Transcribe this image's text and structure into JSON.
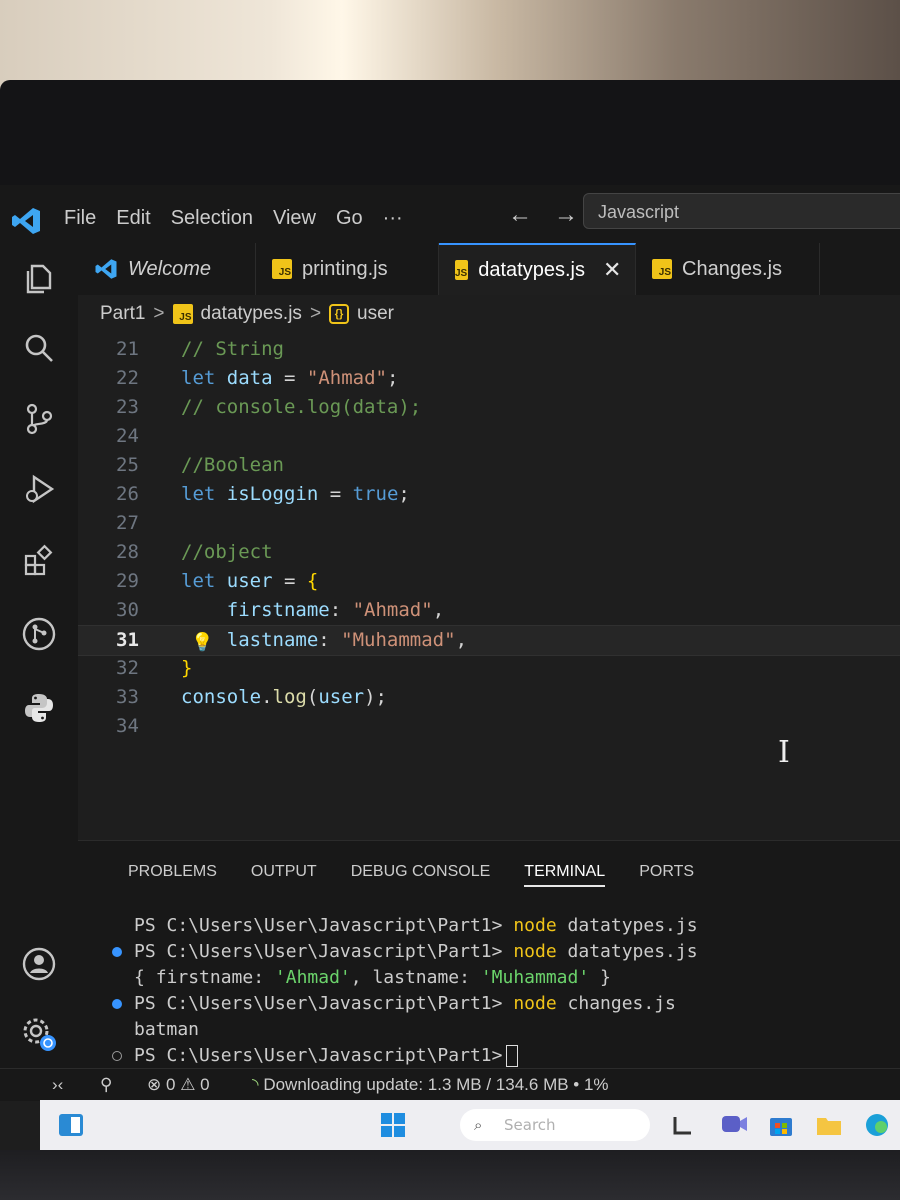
{
  "menu": [
    "File",
    "Edit",
    "Selection",
    "View",
    "Go",
    "···"
  ],
  "command_center": "Javascript",
  "tabs": [
    {
      "label": "Welcome",
      "icon": "vscode-logo-icon",
      "active": false
    },
    {
      "label": "printing.js",
      "icon": "js-file-icon",
      "active": false
    },
    {
      "label": "datatypes.js",
      "icon": "js-file-icon",
      "active": true
    },
    {
      "label": "Changes.js",
      "icon": "js-file-icon",
      "active": false
    }
  ],
  "tab_close": "✕",
  "breadcrumb": {
    "folder": "Part1",
    "file": "datatypes.js",
    "symbol": "user",
    "separator": ">"
  },
  "editor": {
    "current_line": 31,
    "lines": [
      {
        "n": "21",
        "text": "// String"
      },
      {
        "n": "22",
        "text": "let data = \"Ahmad\";"
      },
      {
        "n": "23",
        "text": "// console.log(data);"
      },
      {
        "n": "24",
        "text": ""
      },
      {
        "n": "25",
        "text": "//Boolean"
      },
      {
        "n": "26",
        "text": "let isLoggin = true;"
      },
      {
        "n": "27",
        "text": ""
      },
      {
        "n": "28",
        "text": "//object"
      },
      {
        "n": "29",
        "text": "let user = {"
      },
      {
        "n": "30",
        "text": "    firstname: \"Ahmad\","
      },
      {
        "n": "31",
        "text": "    lastname: \"Muhammad\","
      },
      {
        "n": "32",
        "text": "}"
      },
      {
        "n": "33",
        "text": "console.log(user);"
      },
      {
        "n": "34",
        "text": ""
      }
    ]
  },
  "panel": {
    "tabs": [
      "PROBLEMS",
      "OUTPUT",
      "DEBUG CONSOLE",
      "TERMINAL",
      "PORTS"
    ],
    "active_tab": "TERMINAL"
  },
  "terminal": {
    "prompt": "PS C:\\Users\\User\\Javascript\\Part1>",
    "cmd_node": "node",
    "arg1": "datatypes.js",
    "arg3": "changes.js",
    "output_object": {
      "open": "{ ",
      "k1": "firstname: ",
      "v1": "'Ahmad'",
      "sep": ", ",
      "k2": "lastname: ",
      "v2": "'Muhammad'",
      "close": " }"
    },
    "output_batman": "batman"
  },
  "status": {
    "errors": "0",
    "warnings": "0",
    "update": "Downloading update: 1.3 MB / 134.6 MB • 1%"
  },
  "taskbar": {
    "search_placeholder": "Search"
  },
  "colors": {
    "accent": "#3794ff",
    "js_badge": "#f0c419",
    "keyword": "#569cd6",
    "string": "#ce9178",
    "comment": "#6a9955"
  }
}
